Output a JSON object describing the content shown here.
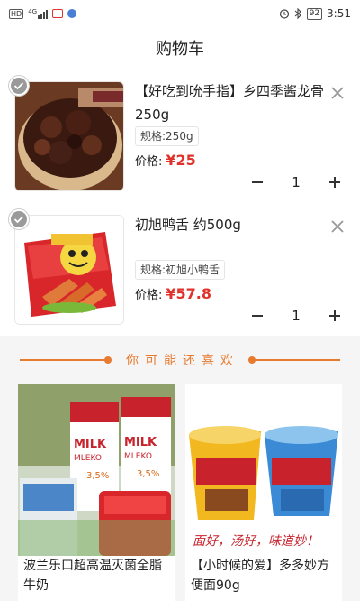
{
  "status_bar": {
    "network_badge": "HD",
    "signal_label": "4G",
    "time": "3:51",
    "battery": "92"
  },
  "header": {
    "title": "购物车"
  },
  "cart": {
    "items": [
      {
        "title": "【好吃到吮手指】乡四季酱龙骨250g",
        "spec": "规格:250g",
        "price_label": "价格:",
        "price": "¥25",
        "quantity": "1"
      },
      {
        "title": "初旭鸭舌 约500g",
        "spec": "规格:初旭小鸭舌",
        "price_label": "价格:",
        "price": "¥57.8",
        "quantity": "1"
      }
    ]
  },
  "recommend": {
    "heading": "你可能还喜欢",
    "items": [
      {
        "title": "波兰乐口超高温灭菌全脂牛奶",
        "image_text": [
          "MILK",
          "MLEKO",
          "3,5%"
        ]
      },
      {
        "title": "【小时候的爱】多多妙方便面90g",
        "image_text": [
          "面好，汤好，味道妙！"
        ]
      }
    ]
  },
  "colors": {
    "accent": "#e77b2f",
    "price": "#e0322b"
  }
}
